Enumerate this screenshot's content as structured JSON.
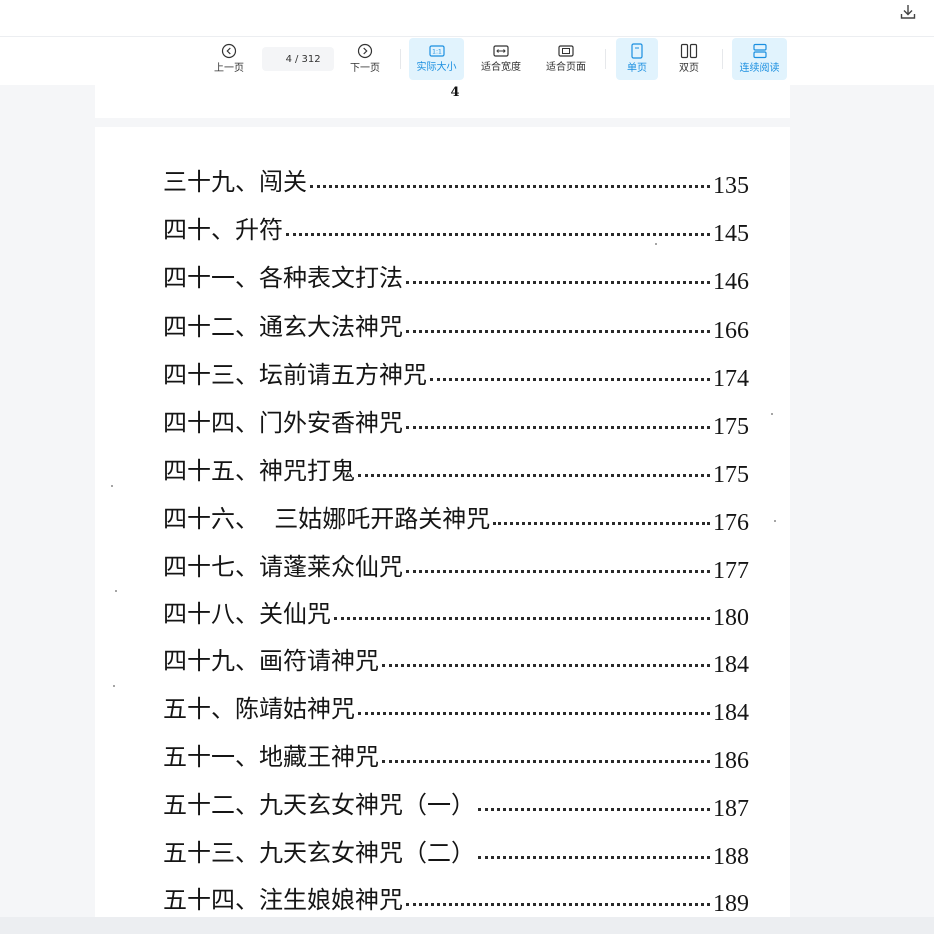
{
  "toolbar": {
    "prev_label": "上一页",
    "next_label": "下一页",
    "current_page": "4",
    "total_pages": "/ 312",
    "actual_size_label": "实际大小",
    "fit_width_label": "适合宽度",
    "fit_page_label": "适合页面",
    "single_page_label": "单页",
    "double_page_label": "双页",
    "continuous_label": "连续阅读"
  },
  "previous_page_number": "4",
  "toc": [
    {
      "title": "三十九、闯关",
      "page": "135"
    },
    {
      "title": "四十、升符",
      "page": "145"
    },
    {
      "title": "四十一、各种表文打法",
      "page": "146"
    },
    {
      "title": "四十二、通玄大法神咒",
      "page": "166"
    },
    {
      "title": "四十三、坛前请五方神咒",
      "page": "174"
    },
    {
      "title": "四十四、门外安香神咒",
      "page": "175"
    },
    {
      "title": "四十五、神咒打鬼",
      "page": "175"
    },
    {
      "title": "四十六、  三姑娜吒开路关神咒",
      "page": "176"
    },
    {
      "title": "四十七、请蓬莱众仙咒",
      "page": "177"
    },
    {
      "title": "四十八、关仙咒",
      "page": "180"
    },
    {
      "title": "四十九、画符请神咒",
      "page": "184"
    },
    {
      "title": "五十、陈靖姑神咒",
      "page": "184"
    },
    {
      "title": "五十一、地藏王神咒",
      "page": "186"
    },
    {
      "title": "五十二、九天玄女神咒（一）",
      "page": "187"
    },
    {
      "title": "五十三、九天玄女神咒（二）",
      "page": "188"
    },
    {
      "title": "五十四、注生娘娘神咒",
      "page": "189"
    }
  ]
}
